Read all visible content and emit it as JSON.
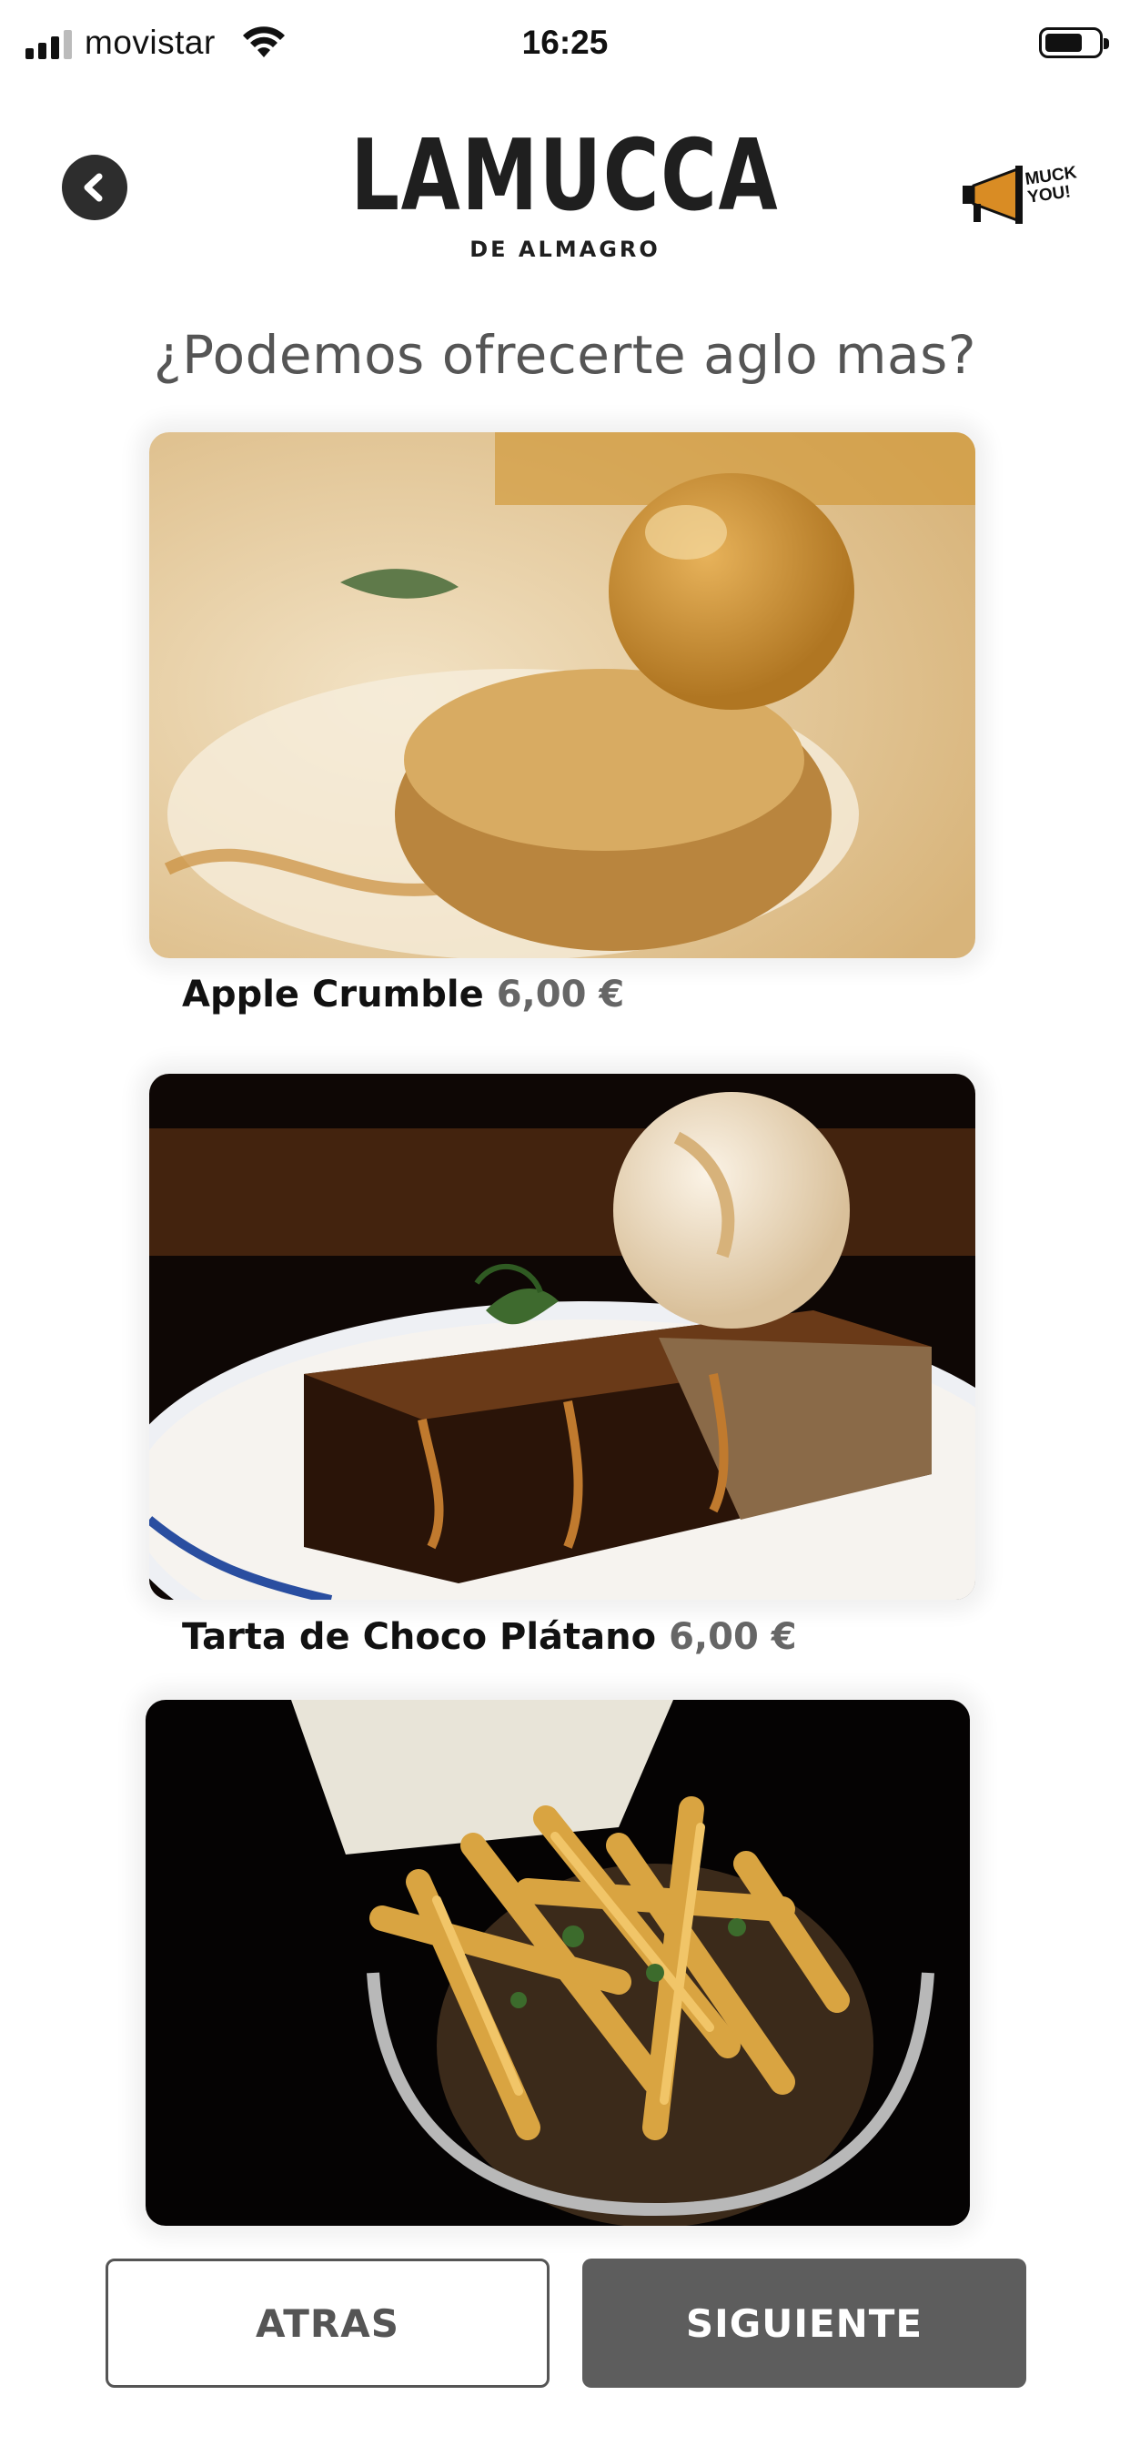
{
  "status_bar": {
    "carrier": "movistar",
    "time": "16:25"
  },
  "header": {
    "logo_main": "LAMUCCA",
    "logo_sub": "DE ALMAGRO",
    "muck_badge_line1": "MUCK",
    "muck_badge_line2": "YOU!"
  },
  "page_title": "¿Podemos ofrecerte aglo mas?",
  "products": [
    {
      "name": "Apple Crumble",
      "price": "6,00 €"
    },
    {
      "name": "Tarta de Choco Plátano",
      "price": "6,00 €"
    },
    {
      "name": "",
      "price": ""
    }
  ],
  "buttons": {
    "back_label": "ATRAS",
    "next_label": "SIGUIENTE"
  },
  "colors": {
    "title_gray": "#555555",
    "next_button_bg": "#5d5d5d",
    "back_button_border": "#555555"
  }
}
